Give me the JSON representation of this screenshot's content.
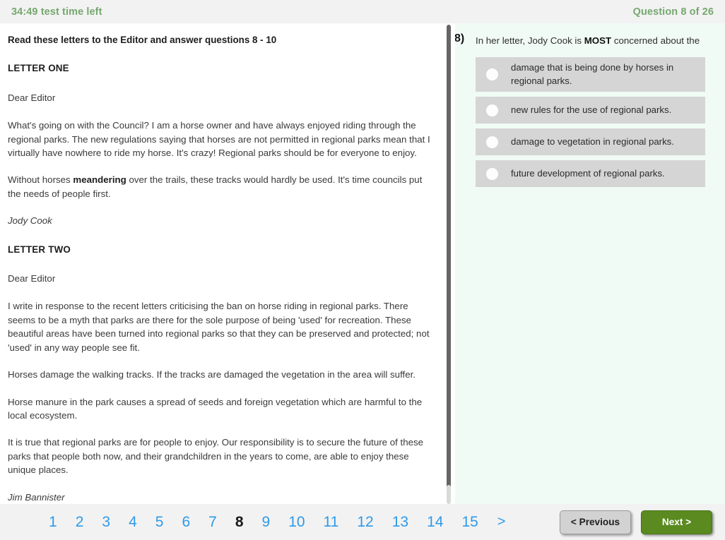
{
  "header": {
    "timer": "34:49 test time left",
    "question_counter": "Question 8 of 26",
    "accent_color": "#76a86f"
  },
  "passage": {
    "instruction": "Read these letters to the Editor and answer questions 8 - 10",
    "letter_one": {
      "heading": "LETTER ONE",
      "salutation": "Dear Editor",
      "paragraph_1": "What's going on with the Council? I am a horse owner and have always enjoyed riding through the regional parks. The new regulations saying that horses are not permitted in regional parks mean that I virtually have nowhere to ride my horse. It's crazy! Regional parks should be for everyone to enjoy.",
      "paragraph_2_before": "Without horses ",
      "paragraph_2_bold": "meandering",
      "paragraph_2_after": " over the trails, these tracks would hardly be used. It's time councils put the needs of people first.",
      "signature": "Jody Cook"
    },
    "letter_two": {
      "heading": "LETTER TWO",
      "salutation": "Dear Editor",
      "paragraph_1": "I write in response to the recent letters criticising the ban on horse riding in regional parks. There seems to be a myth that parks are there for the sole purpose of being 'used' for recreation. These beautiful areas have been turned into regional parks so that they can be preserved and protected; not 'used' in any way people see fit.",
      "paragraph_2": "Horses damage the walking tracks. If the tracks are damaged the vegetation in the area will suffer.",
      "paragraph_3": "Horse manure in the park causes a spread of seeds and foreign vegetation which are harmful to the local ecosystem.",
      "paragraph_4": "It is true that regional parks are for people to enjoy. Our responsibility is to secure the future of these parks that people both now, and their grandchildren in the years to come, are able to enjoy these unique places.",
      "signature": "Jim Bannister"
    }
  },
  "question": {
    "number": "8)",
    "stem_before": "In her letter, Jody Cook is ",
    "stem_emphasis": "MOST",
    "stem_after": " concerned about the",
    "options": [
      {
        "label": "damage that is being done by horses in regional parks.",
        "selected": false
      },
      {
        "label": "new rules for the use of regional parks.",
        "selected": false
      },
      {
        "label": "damage to vegetation in regional parks.",
        "selected": false
      },
      {
        "label": "future development of regional parks.",
        "selected": false
      }
    ]
  },
  "footer": {
    "pages": [
      "1",
      "2",
      "3",
      "4",
      "5",
      "6",
      "7",
      "8",
      "9",
      "10",
      "11",
      "12",
      "13",
      "14",
      "15"
    ],
    "current_page": "8",
    "next_arrow": ">",
    "previous_label": "< Previous",
    "next_label": "Next >",
    "next_color": "#5a8a20"
  }
}
